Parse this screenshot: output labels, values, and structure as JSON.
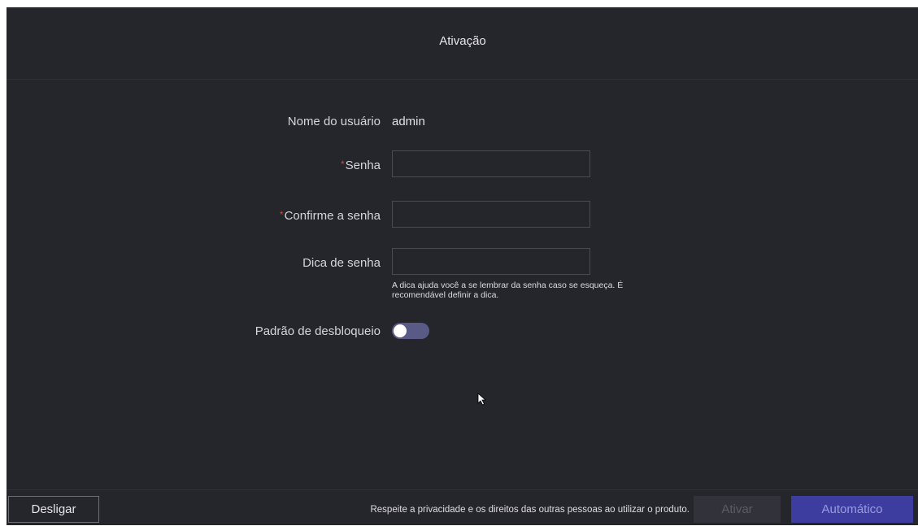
{
  "title": "Ativação",
  "form": {
    "username_label": "Nome do usuário",
    "username_value": "admin",
    "required_mark": "*",
    "password_label": "Senha",
    "password_value": "",
    "confirm_label": "Confirme a senha",
    "confirm_value": "",
    "hint_label": "Dica de senha",
    "hint_value": "",
    "hint_help_line1": "A dica ajuda você a se lembrar da senha caso se esqueça. É",
    "hint_help_line2": "recomendável definir a dica.",
    "unlock_pattern_label": "Padrão de desbloqueio",
    "unlock_pattern_enabled": false
  },
  "footer": {
    "shutdown_label": "Desligar",
    "privacy_notice": "Respeite a privacidade e os direitos das outras pessoas ao utilizar o produto.",
    "activate_label": "Ativar",
    "auto_label": "Automático"
  },
  "colors": {
    "background": "#25252c",
    "required": "#e0412e",
    "accent": "#3d3da0",
    "toggle_track": "#5a5a86"
  },
  "icons": {
    "cursor": "mouse-pointer-icon"
  }
}
